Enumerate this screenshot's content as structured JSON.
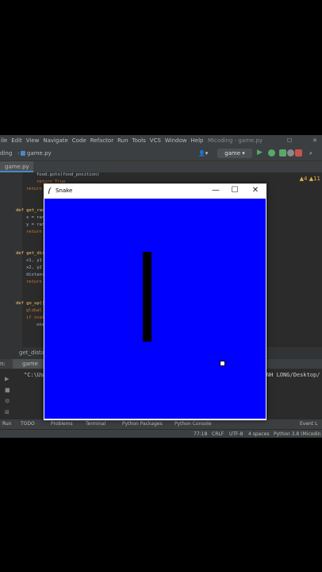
{
  "ide": {
    "menu": [
      "ile",
      "Edit",
      "View",
      "Navigate",
      "Code",
      "Refactor",
      "Run",
      "Tools",
      "VCS",
      "Window",
      "Help"
    ],
    "window_title": "Micoding - game.py",
    "project_crumb": "ding",
    "file_crumb": "game.py",
    "run_config": "game",
    "editor_tab": "game.py",
    "warnings": "▲4  ▲11",
    "code": [
      "food.goto(food_position)",
      "return True",
      "return",
      "def get_ran",
      "x = ran",
      "y = ran",
      "return",
      "def get_dis",
      "x1, y1",
      "x2, y2",
      "distanc",
      "return",
      "def go_up()",
      "global",
      "if snak",
      "sna"
    ],
    "breadcrumb": "get_distan",
    "run_label": "n:",
    "run_tab": "game",
    "console_left": "\"C:\\Us",
    "console_right": "NH LONG/Desktop/",
    "tool_windows": [
      "Run",
      "TODO",
      "Problems",
      "Terminal",
      "Python Packages",
      "Python Console",
      "Event L"
    ],
    "status": {
      "position": "77:18",
      "line_sep": "CRLF",
      "encoding": "UTF-8",
      "indent": "4 spaces",
      "interpreter": "Python 3.8 (Micodin"
    }
  },
  "snake_window": {
    "title": "Snake",
    "minimize": "—",
    "maximize": "☐",
    "close": "✕",
    "background_color": "#0000ff",
    "snake_color": "#000000",
    "food_color": "#ffffff"
  }
}
